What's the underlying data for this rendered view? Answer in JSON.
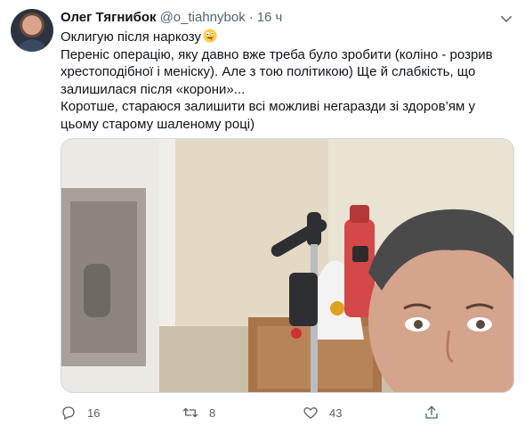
{
  "tweet": {
    "author_name": "Олег Тягнибок",
    "author_handle": "@o_tiahnybok",
    "separator": "·",
    "time": "16 ч",
    "text_line1": "Оклигую після наркозу",
    "text_para2": "Переніс операцію, яку давно вже треба було зробити (коліно - розрив хрестоподібної і меніску). Але з тою політикою) Ще й слабкість, що залишилася після «корони»...",
    "text_para3": "Коротше, стараюся залишити всі можливі негаразди зі здоров’ям у цьому старому шаленому році)",
    "emoji": "zany-face-emoji"
  },
  "actions": {
    "reply_count": "16",
    "retweet_count": "8",
    "like_count": "43"
  },
  "icons": {
    "caret": "chevron-down-icon",
    "reply": "reply-icon",
    "retweet": "retweet-icon",
    "like": "heart-icon",
    "share": "share-icon"
  },
  "colors": {
    "text": "#0f1419",
    "secondary": "#536471",
    "border": "#cfd9de"
  }
}
